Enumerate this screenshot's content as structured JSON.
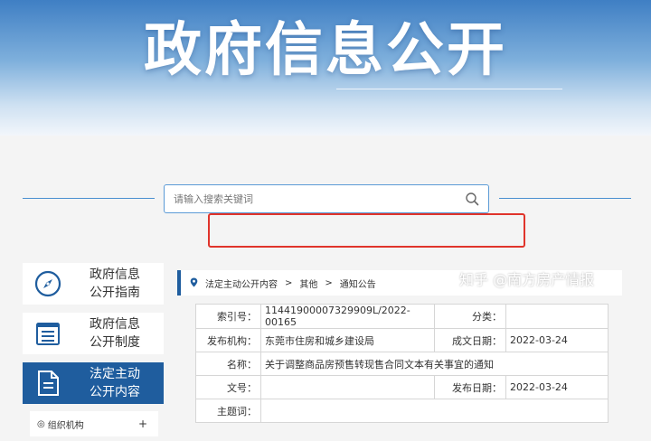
{
  "banner": {
    "title": "政府信息公开"
  },
  "search": {
    "placeholder": "请输入搜索关键词"
  },
  "sidebar": {
    "items": [
      {
        "label": "政府信息\n公开指南",
        "icon": "compass-icon"
      },
      {
        "label": "政府信息\n公开制度",
        "icon": "list-document-icon"
      },
      {
        "label": "法定主动\n公开内容",
        "icon": "document-icon",
        "active": true
      }
    ],
    "sub_item": {
      "label": "组织机构",
      "icon": "org-icon",
      "expand": "+"
    }
  },
  "breadcrumb": {
    "items": [
      "法定主动公开内容",
      "其他",
      "通知公告"
    ],
    "separator": ">"
  },
  "info": {
    "index_label": "索引号：",
    "index_value": "11441900007329909L/2022-00165",
    "category_label": "分类：",
    "category_value": "",
    "publisher_label": "发布机构：",
    "publisher_value": "东莞市住房和城乡建设局",
    "created_label": "成文日期：",
    "created_value": "2022-03-24",
    "name_label": "名称：",
    "name_value": "关于调整商品房预售转现售合同文本有关事宜的通知",
    "docno_label": "文号：",
    "docno_value": "",
    "published_label": "发布日期：",
    "published_value": "2022-03-24",
    "subject_label": "主题词：",
    "subject_value": ""
  },
  "watermark": "知乎 @南方房产情报",
  "colors": {
    "accent": "#1f5d9e",
    "highlight": "#e0342b",
    "search_border": "#5b9ad6"
  }
}
